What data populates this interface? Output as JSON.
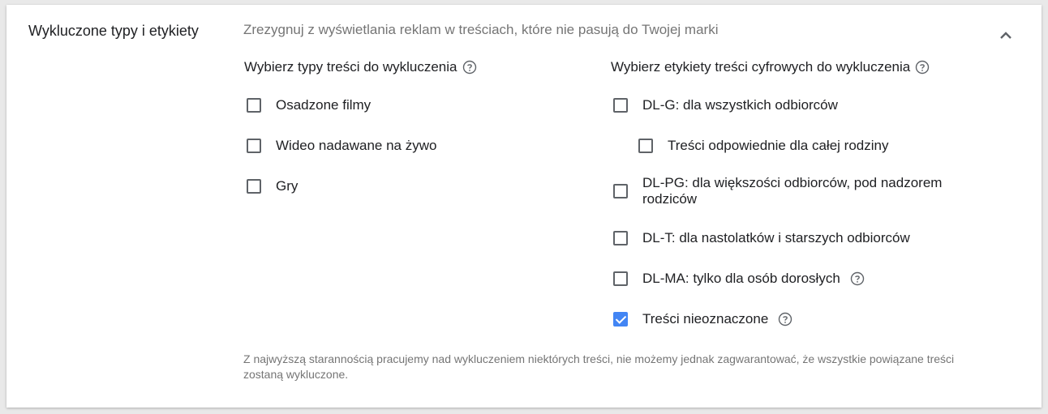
{
  "section": {
    "title": "Wykluczone typy i etykiety",
    "description": "Zrezygnuj z wyświetlania reklam w treściach, które nie pasują do Twojej marki",
    "collapse_icon": "chevron-up-icon"
  },
  "content_types": {
    "heading": "Wybierz typy treści do wykluczenia",
    "options": [
      {
        "label": "Osadzone filmy",
        "checked": false
      },
      {
        "label": "Wideo nadawane na żywo",
        "checked": false
      },
      {
        "label": "Gry",
        "checked": false
      }
    ]
  },
  "digital_labels": {
    "heading": "Wybierz etykiety treści cyfrowych do wykluczenia",
    "options": [
      {
        "label": "DL-G: dla wszystkich odbiorców",
        "checked": false
      },
      {
        "label": "Treści odpowiednie dla całej rodziny",
        "checked": false
      },
      {
        "label": "DL-PG: dla większości odbiorców, pod nadzorem rodziców",
        "checked": false
      },
      {
        "label": "DL-T: dla nastolatków i starszych odbiorców",
        "checked": false
      },
      {
        "label": "DL-MA: tylko dla osób dorosłych",
        "checked": false
      },
      {
        "label": "Treści nieoznaczone",
        "checked": true
      }
    ]
  },
  "footnote": "Z najwyższą starannością pracujemy nad wykluczeniem niektórych treści, nie możemy jednak zagwarantować, że wszystkie powiązane treści zostaną wykluczone.",
  "colors": {
    "accent": "#4285f4",
    "text": "#202124",
    "muted": "#757575"
  }
}
